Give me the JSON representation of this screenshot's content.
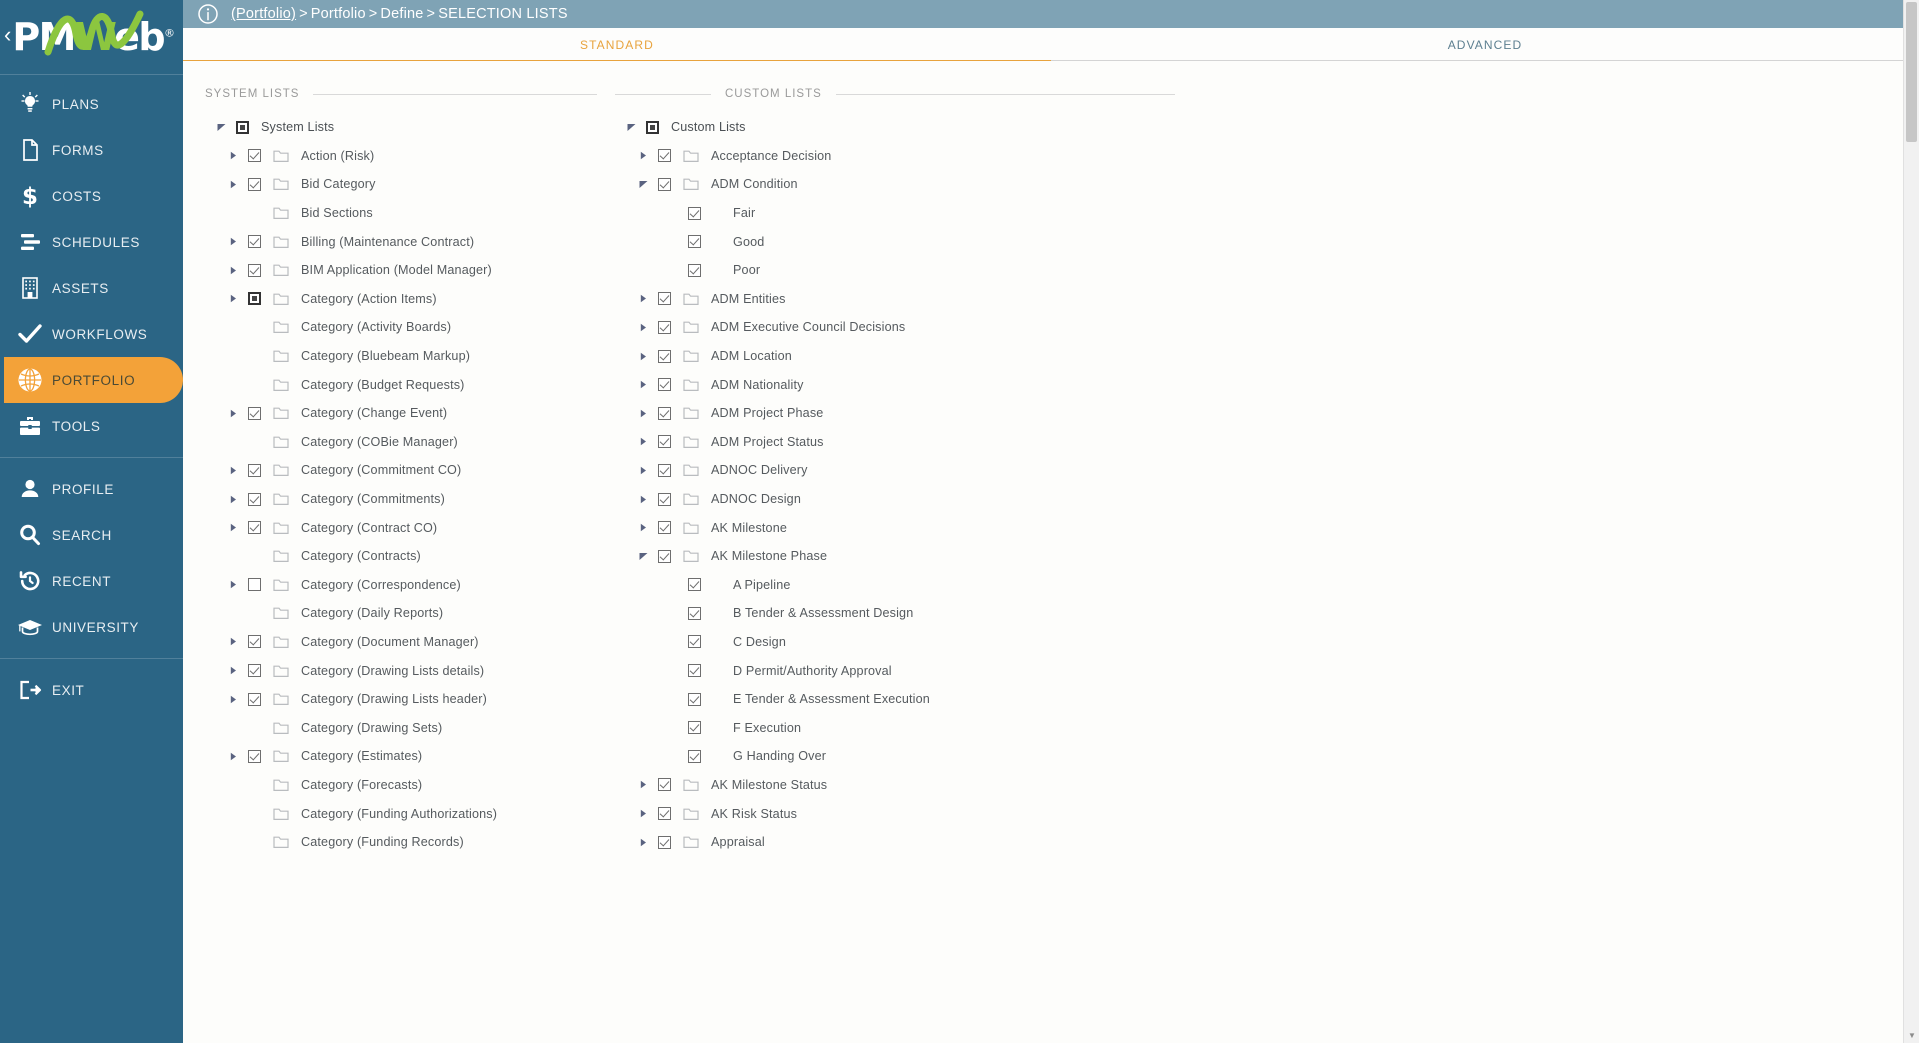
{
  "colors": {
    "sidebar_bg": "#2b6585",
    "accent_orange": "#f3a239",
    "topbar_bg": "#7fa3b5",
    "logo_green": "#8cc63f",
    "tab_active": "#e8a33d"
  },
  "sidebar": {
    "logo": {
      "pm": "PM",
      "w": "W",
      "eb": "eb",
      "reg": "®"
    },
    "collapse_label": "‹",
    "items": [
      {
        "label": "PLANS",
        "icon": "lightbulb-icon",
        "active": false
      },
      {
        "label": "FORMS",
        "icon": "document-icon",
        "active": false
      },
      {
        "label": "COSTS",
        "icon": "dollar-icon",
        "active": false
      },
      {
        "label": "SCHEDULES",
        "icon": "gantt-icon",
        "active": false
      },
      {
        "label": "ASSETS",
        "icon": "building-icon",
        "active": false
      },
      {
        "label": "WORKFLOWS",
        "icon": "checkmark-icon",
        "active": false
      },
      {
        "label": "PORTFOLIO",
        "icon": "globe-icon",
        "active": true
      },
      {
        "label": "TOOLS",
        "icon": "toolbox-icon",
        "active": false
      }
    ],
    "items2": [
      {
        "label": "PROFILE",
        "icon": "person-icon",
        "active": false
      },
      {
        "label": "SEARCH",
        "icon": "search-icon",
        "active": false
      },
      {
        "label": "RECENT",
        "icon": "history-icon",
        "active": false
      },
      {
        "label": "UNIVERSITY",
        "icon": "graduation-cap-icon",
        "active": false
      }
    ],
    "items3": [
      {
        "label": "EXIT",
        "icon": "exit-icon",
        "active": false
      }
    ]
  },
  "topbar": {
    "info_icon": "info-icon",
    "breadcrumb": {
      "root": "(Portfolio)",
      "sep": ">",
      "crumb2": "Portfolio",
      "crumb3": "Define",
      "current": "SELECTION LISTS"
    }
  },
  "tabs": [
    {
      "label": "STANDARD",
      "active": true
    },
    {
      "label": "ADVANCED",
      "active": false
    }
  ],
  "system_lists": {
    "header": "SYSTEM LISTS",
    "root": {
      "label": "System Lists",
      "check": "partial",
      "twist": "expanded"
    },
    "items": [
      {
        "label": "Action (Risk)",
        "check": "checked",
        "twist": "collapsed"
      },
      {
        "label": "Bid Category",
        "check": "checked",
        "twist": "collapsed"
      },
      {
        "label": "Bid Sections",
        "check": "none",
        "twist": "none"
      },
      {
        "label": "Billing (Maintenance Contract)",
        "check": "checked",
        "twist": "collapsed"
      },
      {
        "label": "BIM Application (Model Manager)",
        "check": "checked",
        "twist": "collapsed"
      },
      {
        "label": "Category (Action Items)",
        "check": "partial",
        "twist": "collapsed"
      },
      {
        "label": "Category (Activity Boards)",
        "check": "none",
        "twist": "none"
      },
      {
        "label": "Category (Bluebeam Markup)",
        "check": "none",
        "twist": "none"
      },
      {
        "label": "Category (Budget Requests)",
        "check": "none",
        "twist": "none"
      },
      {
        "label": "Category (Change Event)",
        "check": "checked",
        "twist": "collapsed"
      },
      {
        "label": "Category (COBie Manager)",
        "check": "none",
        "twist": "none"
      },
      {
        "label": "Category (Commitment CO)",
        "check": "checked",
        "twist": "collapsed"
      },
      {
        "label": "Category (Commitments)",
        "check": "checked",
        "twist": "collapsed"
      },
      {
        "label": "Category (Contract CO)",
        "check": "checked",
        "twist": "collapsed"
      },
      {
        "label": "Category (Contracts)",
        "check": "none",
        "twist": "none"
      },
      {
        "label": "Category (Correspondence)",
        "check": "unchecked",
        "twist": "collapsed"
      },
      {
        "label": "Category (Daily Reports)",
        "check": "none",
        "twist": "none"
      },
      {
        "label": "Category (Document Manager)",
        "check": "checked",
        "twist": "collapsed"
      },
      {
        "label": "Category (Drawing Lists details)",
        "check": "checked",
        "twist": "collapsed"
      },
      {
        "label": "Category (Drawing Lists header)",
        "check": "checked",
        "twist": "collapsed"
      },
      {
        "label": "Category (Drawing Sets)",
        "check": "none",
        "twist": "none"
      },
      {
        "label": "Category (Estimates)",
        "check": "checked",
        "twist": "collapsed"
      },
      {
        "label": "Category (Forecasts)",
        "check": "none",
        "twist": "none"
      },
      {
        "label": "Category (Funding Authorizations)",
        "check": "none",
        "twist": "none"
      },
      {
        "label": "Category (Funding Records)",
        "check": "none",
        "twist": "none"
      }
    ]
  },
  "custom_lists": {
    "header": "CUSTOM LISTS",
    "root": {
      "label": "Custom Lists",
      "check": "partial",
      "twist": "expanded"
    },
    "items": [
      {
        "label": "Acceptance Decision",
        "check": "checked",
        "twist": "collapsed",
        "level": 1
      },
      {
        "label": "ADM Condition",
        "check": "checked",
        "twist": "expanded",
        "level": 1
      },
      {
        "label": "Fair",
        "check": "checked",
        "twist": "none",
        "level": 2
      },
      {
        "label": "Good",
        "check": "checked",
        "twist": "none",
        "level": 2
      },
      {
        "label": "Poor",
        "check": "checked",
        "twist": "none",
        "level": 2
      },
      {
        "label": "ADM Entities",
        "check": "checked",
        "twist": "collapsed",
        "level": 1
      },
      {
        "label": "ADM Executive Council Decisions",
        "check": "checked",
        "twist": "collapsed",
        "level": 1
      },
      {
        "label": "ADM Location",
        "check": "checked",
        "twist": "collapsed",
        "level": 1
      },
      {
        "label": "ADM Nationality",
        "check": "checked",
        "twist": "collapsed",
        "level": 1
      },
      {
        "label": "ADM Project Phase",
        "check": "checked",
        "twist": "collapsed",
        "level": 1
      },
      {
        "label": "ADM Project Status",
        "check": "checked",
        "twist": "collapsed",
        "level": 1
      },
      {
        "label": "ADNOC Delivery",
        "check": "checked",
        "twist": "collapsed",
        "level": 1
      },
      {
        "label": "ADNOC Design",
        "check": "checked",
        "twist": "collapsed",
        "level": 1
      },
      {
        "label": "AK Milestone",
        "check": "checked",
        "twist": "collapsed",
        "level": 1
      },
      {
        "label": "AK Milestone Phase",
        "check": "checked",
        "twist": "expanded",
        "level": 1
      },
      {
        "label": "A Pipeline",
        "check": "checked",
        "twist": "none",
        "level": 2
      },
      {
        "label": "B Tender & Assessment Design",
        "check": "checked",
        "twist": "none",
        "level": 2
      },
      {
        "label": "C Design",
        "check": "checked",
        "twist": "none",
        "level": 2
      },
      {
        "label": "D Permit/Authority Approval",
        "check": "checked",
        "twist": "none",
        "level": 2
      },
      {
        "label": "E Tender & Assessment Execution",
        "check": "checked",
        "twist": "none",
        "level": 2
      },
      {
        "label": "F Execution",
        "check": "checked",
        "twist": "none",
        "level": 2
      },
      {
        "label": "G Handing Over",
        "check": "checked",
        "twist": "none",
        "level": 2
      },
      {
        "label": "AK Milestone Status",
        "check": "checked",
        "twist": "collapsed",
        "level": 1
      },
      {
        "label": "AK Risk Status",
        "check": "checked",
        "twist": "collapsed",
        "level": 1
      },
      {
        "label": "Appraisal",
        "check": "checked",
        "twist": "collapsed",
        "level": 1
      }
    ]
  },
  "scrollbar": {
    "up_arrow": "▲",
    "down_arrow": "▼"
  }
}
